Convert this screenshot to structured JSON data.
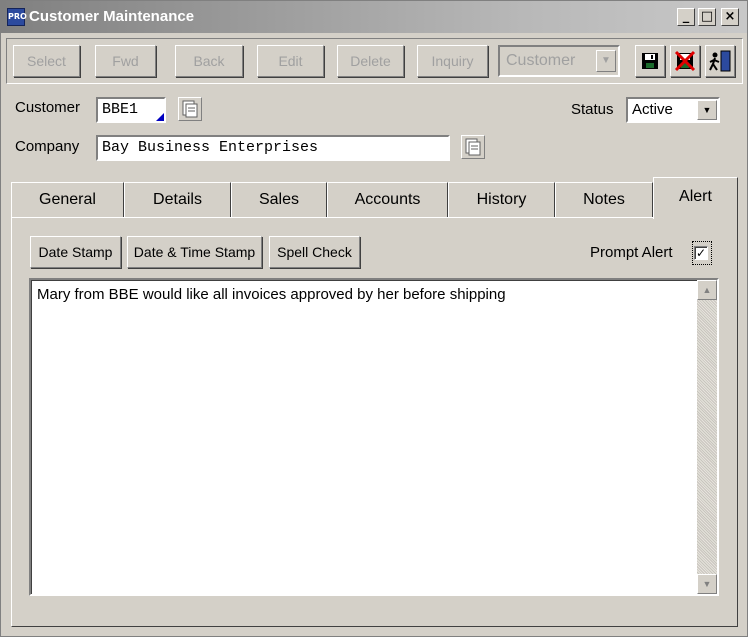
{
  "window": {
    "title": "Customer Maintenance",
    "app_badge": "PRO"
  },
  "toolbar": {
    "select_label": "Select",
    "fwd_label": "Fwd",
    "back_label": "Back",
    "edit_label": "Edit",
    "delete_label": "Delete",
    "inquiry_label": "Inquiry",
    "entity_value": "Customer",
    "icons": [
      "save-icon",
      "cancel-icon",
      "exit-icon"
    ]
  },
  "form": {
    "customer_label": "Customer",
    "customer_value": "BBE1",
    "company_label": "Company",
    "company_value": "Bay Business Enterprises",
    "status_label": "Status",
    "status_value": "Active"
  },
  "tabs": [
    {
      "label": "General"
    },
    {
      "label": "Details"
    },
    {
      "label": "Sales"
    },
    {
      "label": "Accounts"
    },
    {
      "label": "History"
    },
    {
      "label": "Notes"
    },
    {
      "label": "Alert"
    }
  ],
  "active_tab": "Alert",
  "alert": {
    "date_stamp_label": "Date Stamp",
    "date_time_stamp_label": "Date & Time Stamp",
    "spell_check_label": "Spell Check",
    "prompt_alert_label": "Prompt Alert",
    "prompt_alert_checked": true,
    "text": "Mary from BBE would like all invoices approved by her before shipping"
  },
  "colors": {
    "face": "#d4d0c8",
    "title_gradient_start": "#808080",
    "disabled_text": "#a0a0a0"
  }
}
